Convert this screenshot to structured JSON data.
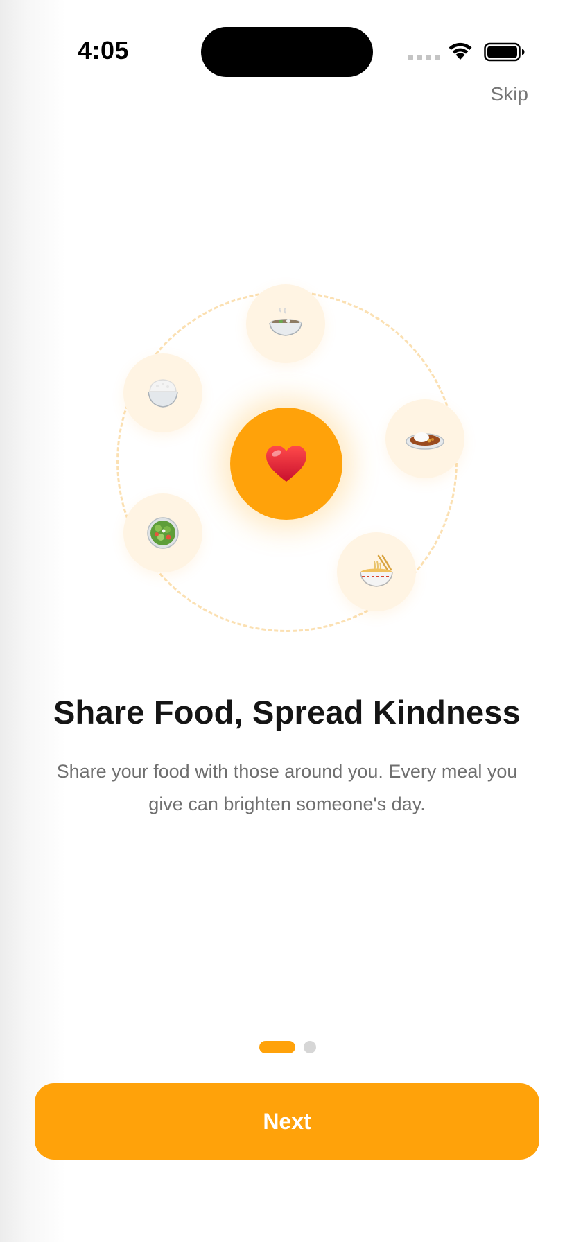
{
  "status_bar": {
    "time": "4:05"
  },
  "header": {
    "skip_label": "Skip"
  },
  "illustration": {
    "center_icon": "heart-icon",
    "food_icons": [
      "noodle-soup-icon",
      "rice-bowl-icon",
      "curry-rice-icon",
      "salad-icon",
      "ramen-icon"
    ]
  },
  "content": {
    "title": "Share Food, Spread Kindness",
    "subtitle": "Share your food with those around you. Every meal you give can brighten someone's day."
  },
  "pager": {
    "total_pages": 2,
    "current_page": 1
  },
  "actions": {
    "next_label": "Next"
  },
  "colors": {
    "accent": "#FFA20A",
    "bubble": "#FFF4E3",
    "orbit": "#FBE0B2",
    "title": "#151515",
    "subtitle": "#6F6F6F"
  }
}
